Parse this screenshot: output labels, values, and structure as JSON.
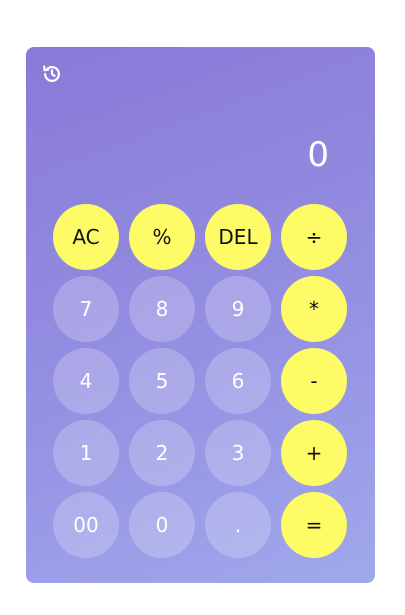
{
  "calculator": {
    "history_icon": "history-icon",
    "display_value": "0",
    "colors": {
      "accent": "#fdfb66",
      "panel_gradient_start": "#8979d8",
      "panel_gradient_end": "#a0a8ec"
    },
    "keys": {
      "ac": "AC",
      "percent": "%",
      "del": "DEL",
      "divide": "÷",
      "seven": "7",
      "eight": "8",
      "nine": "9",
      "multiply": "*",
      "four": "4",
      "five": "5",
      "six": "6",
      "minus": "-",
      "one": "1",
      "two": "2",
      "three": "3",
      "plus": "+",
      "double_zero": "00",
      "zero": "0",
      "decimal": ".",
      "equals": "="
    }
  }
}
